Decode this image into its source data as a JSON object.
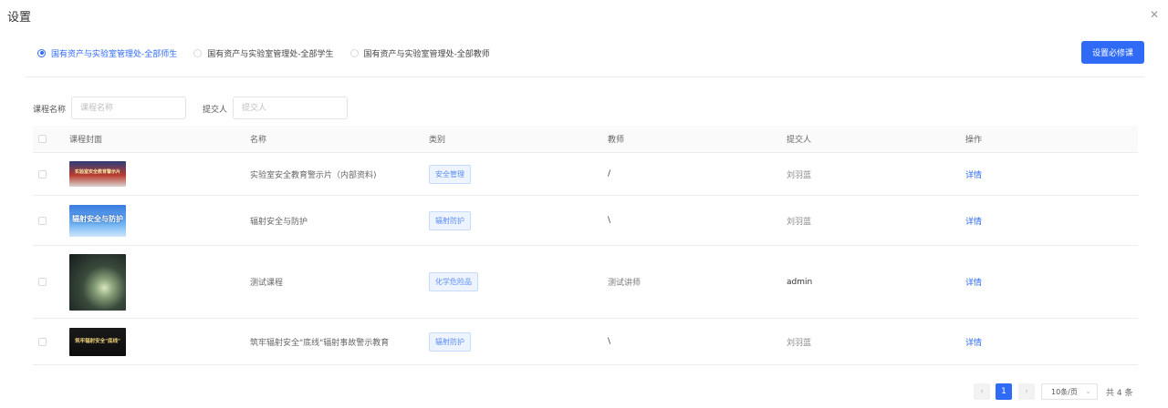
{
  "dialog": {
    "title": "设置",
    "close_icon": "close-icon"
  },
  "radios": [
    {
      "label": "国有资产与实验室管理处-全部师生",
      "checked": true
    },
    {
      "label": "国有资产与实验室管理处-全部学生",
      "checked": false
    },
    {
      "label": "国有资产与实验室管理处-全部教师",
      "checked": false
    }
  ],
  "actions": {
    "set_required_label": "设置必修课"
  },
  "filters": {
    "course_name_label": "课程名称",
    "course_name_placeholder": "课程名称",
    "submitter_label": "提交人",
    "submitter_placeholder": "提交人"
  },
  "table": {
    "headers": [
      "课程封面",
      "名称",
      "类别",
      "教师",
      "提交人",
      "操作"
    ],
    "rows": [
      {
        "cover_text": "实验室安全教育警示片",
        "name": "实验室安全教育警示片（内部资料)",
        "category": "安全管理",
        "teacher": "/",
        "submitter": "刘羽蓝",
        "action": "详情"
      },
      {
        "cover_text": "辐射安全与防护",
        "name": "辐射安全与防护",
        "category": "辐射防护",
        "teacher": "\\",
        "submitter": "刘羽蓝",
        "action": "详情"
      },
      {
        "cover_text": "",
        "name": "测试课程",
        "category": "化学危险品",
        "teacher": "测试讲师",
        "submitter": "admin",
        "action": "详情"
      },
      {
        "cover_text": "筑牢辐射安全\"底线\"",
        "name": "筑牢辐射安全\"底线\"辐射事故警示教育",
        "category": "辐射防护",
        "teacher": "\\",
        "submitter": "刘羽蓝",
        "action": "详情"
      }
    ]
  },
  "pagination": {
    "prev": "‹",
    "current_page": "1",
    "next": "›",
    "page_size": "10条/页",
    "total": "共 4 条"
  },
  "colors": {
    "primary": "#2f6bf6",
    "tag_bg": "#eef4ff",
    "tag_text": "#5a8cf8"
  }
}
